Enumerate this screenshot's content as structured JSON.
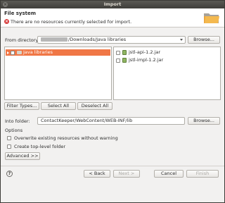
{
  "window": {
    "title": "Import"
  },
  "header": {
    "title": "File system",
    "message": "There are no resources currently selected for import."
  },
  "from_directory": {
    "label": "From directory:",
    "path_suffix": "/Downloads/Java libraries",
    "browse_label": "Browse..."
  },
  "tree": {
    "folder_label": "Java libraries"
  },
  "files": [
    {
      "name": "jstl-api-1.2.jar",
      "checked": false
    },
    {
      "name": "jstl-impl-1.2.jar",
      "checked": false
    }
  ],
  "selection_buttons": {
    "filter_types": "Filter Types...",
    "select_all": "Select All",
    "deselect_all": "Deselect All"
  },
  "into_folder": {
    "label": "Into folder:",
    "value": "ContactKeeper/WebContent/WEB-INF/lib",
    "browse_label": "Browse..."
  },
  "options": {
    "legend": "Options",
    "overwrite_label": "Overwrite existing resources without warning",
    "create_top_level_label": "Create top-level folder",
    "advanced_label": "Advanced >>"
  },
  "footer": {
    "back_label": "< Back",
    "next_label": "Next >",
    "cancel_label": "Cancel",
    "finish_label": "Finish"
  }
}
